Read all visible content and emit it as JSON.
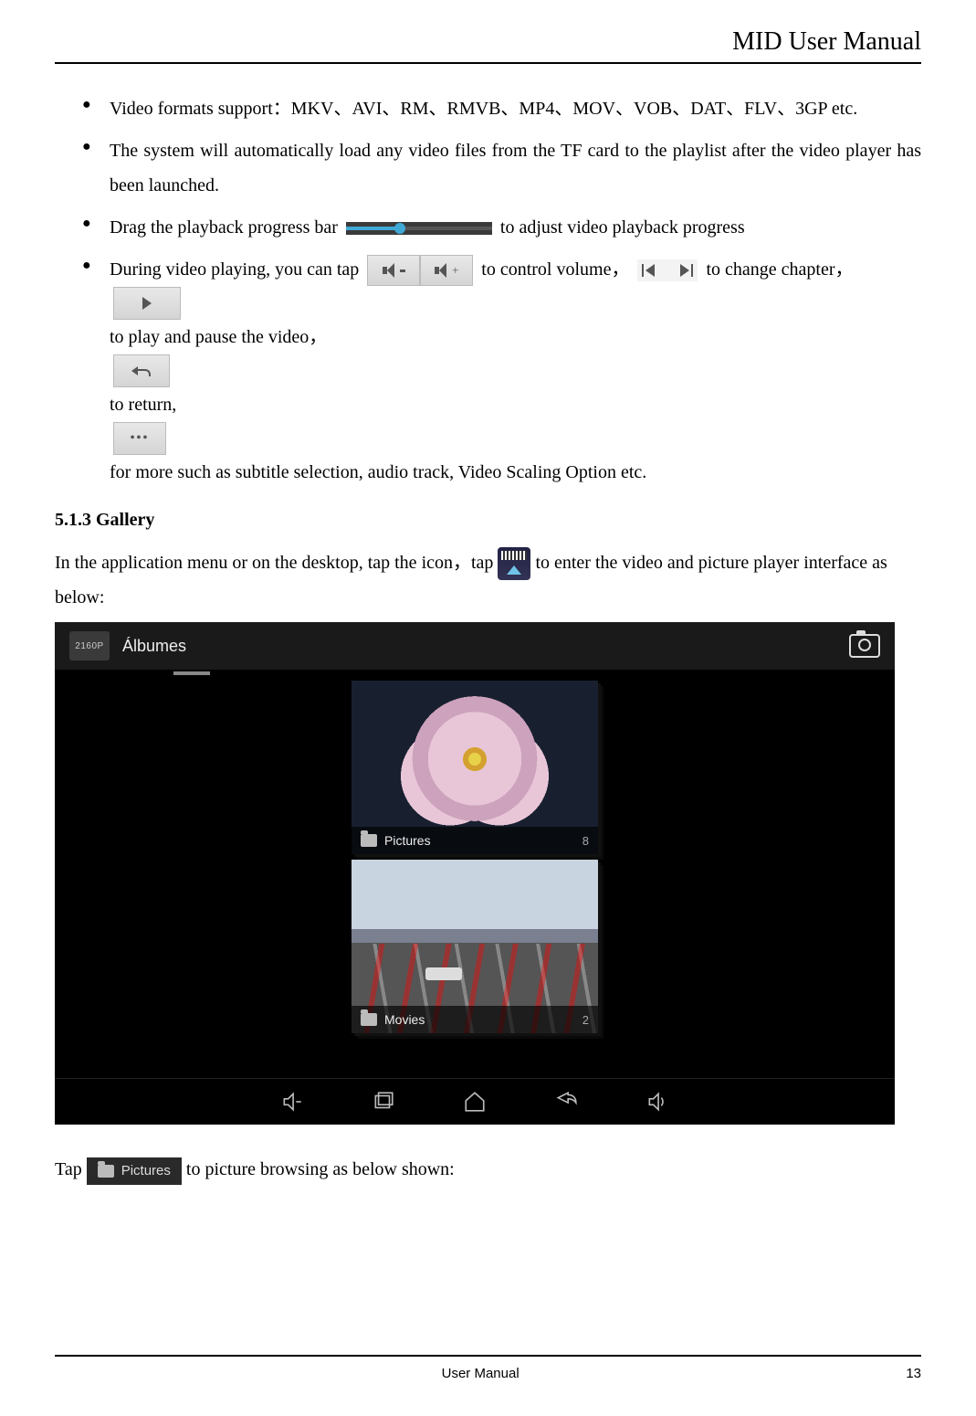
{
  "header": {
    "title": "MID User Manual"
  },
  "bullets": {
    "b1": "Video formats support：MKV、AVI、RM、RMVB、MP4、MOV、VOB、DAT、FLV、3GP etc.",
    "b2": "The system will automatically load any video files from the TF card to the playlist after the video player has been launched.",
    "b3_pre": "Drag the playback progress bar ",
    "b3_post": " to adjust video playback progress",
    "b4_s1": "During video playing, you can tap",
    "b4_s2": " to control volume，",
    "b4_s3": "to change chapter，",
    "b4_s4": " to play and pause the video，",
    "b4_s5": "to return,",
    "b4_s6": " for more such as subtitle selection, audio track, Video Scaling Option etc."
  },
  "section": {
    "heading": "5.1.3 Gallery"
  },
  "gallery_intro": {
    "pre": "In the application menu or on the desktop, tap the icon，tap ",
    "post": " to enter the video and picture player interface as below:"
  },
  "screenshot": {
    "logo_text": "2160P",
    "title": "Álbumes",
    "folders": {
      "pictures": {
        "label": "Pictures",
        "count": "8"
      },
      "movies": {
        "label": "Movies",
        "count": "2"
      }
    }
  },
  "tap_line": {
    "pre": "Tap ",
    "button_label": "Pictures",
    "post": " to picture browsing as below shown:"
  },
  "footer": {
    "center": "User Manual",
    "page": "13"
  }
}
